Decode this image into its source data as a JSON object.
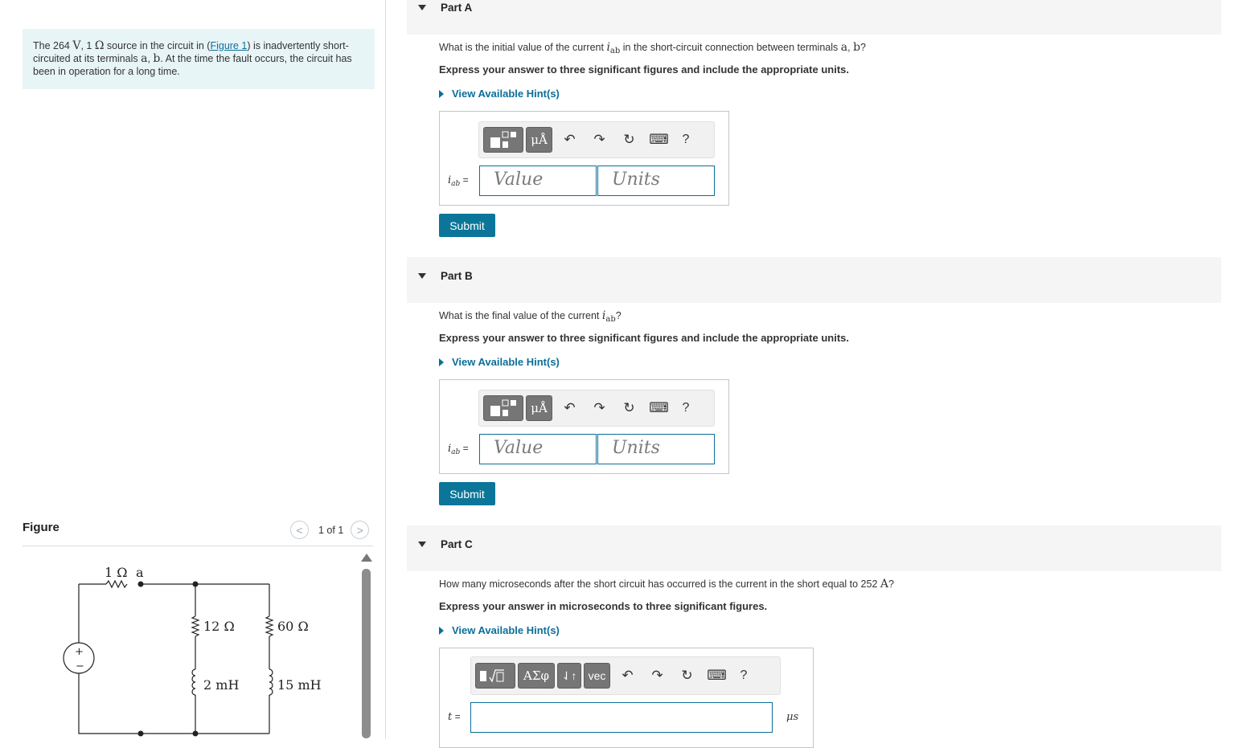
{
  "intro": {
    "pre": "The 264 ",
    "v_unit": "V",
    "mid1": ", 1 ",
    "ohm": "Ω",
    "mid2": " source in the circuit in (",
    "link": "Figure 1",
    "mid3": ") is inadvertently short-circuited at its terminals ",
    "term_a": "a",
    "comma": ", ",
    "term_b": "b",
    "post": ". At the time the fault occurs, the circuit has been in operation for a long time."
  },
  "figure": {
    "label": "Figure",
    "counter": "1 of 1",
    "prev": "<",
    "next": ">",
    "circuit_labels": {
      "r_source": "1 Ω",
      "terminal_a": "a",
      "r12": "12 Ω",
      "r60": "60 Ω",
      "l2": "2 mH",
      "l15": "15 mH",
      "plus": "+",
      "minus": "−"
    }
  },
  "partA": {
    "title": "Part A",
    "q_pre": "What is the initial value of the current ",
    "q_var": "i",
    "q_sub": "ab",
    "q_post": " in the short-circuit connection between terminals ",
    "q_a": "a",
    "q_comma": ", ",
    "q_b": "b",
    "q_end": "?",
    "instruction": "Express your answer to three significant figures and include the appropriate units.",
    "hint": "View Available Hint(s)",
    "eq_var": "i",
    "eq_sub": "ab",
    "eq_sign": " =",
    "value_placeholder": "Value",
    "units_placeholder": "Units",
    "submit": "Submit"
  },
  "partB": {
    "title": "Part B",
    "q_pre": "What is the final value of the current ",
    "q_var": "i",
    "q_sub": "ab",
    "q_end": "?",
    "instruction": "Express your answer to three significant figures and include the appropriate units.",
    "hint": "View Available Hint(s)",
    "eq_var": "i",
    "eq_sub": "ab",
    "eq_sign": " =",
    "value_placeholder": "Value",
    "units_placeholder": "Units",
    "submit": "Submit"
  },
  "partC": {
    "title": "Part C",
    "q_pre": "How many microseconds after the short circuit has occurred is the current in the short equal to 252 ",
    "q_unit": "A",
    "q_end": "?",
    "instruction": "Express your answer in microseconds to three significant figures.",
    "hint": "View Available Hint(s)",
    "eq_var": "t",
    "eq_sign": " =",
    "unit": "μs"
  },
  "toolbar": {
    "units_btn": "μÅ",
    "greek_btn": "ΑΣφ",
    "arrows_btn": "⇃↑",
    "vec_btn": "vec",
    "undo": "↶",
    "redo": "↷",
    "reset": "↻",
    "keyboard": "⌨",
    "help": "?"
  },
  "colors": {
    "accent": "#0b7699",
    "link": "#0b6e99",
    "intro_bg": "#e8f5f7",
    "part_bg": "#f5f5f5"
  }
}
